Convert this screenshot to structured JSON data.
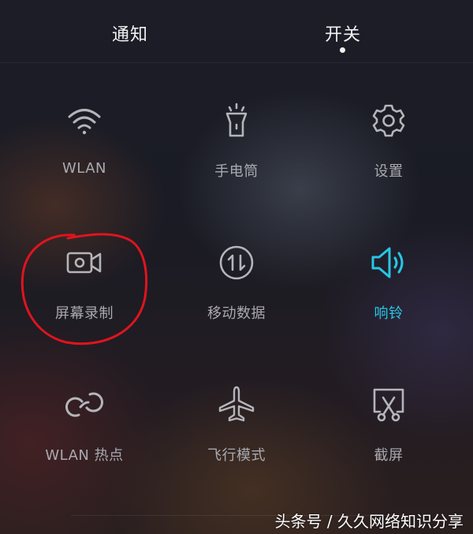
{
  "tabs": {
    "notify": "通知",
    "switch": "开关",
    "active": "开关"
  },
  "tiles": [
    {
      "label": "WLAN",
      "icon": "wifi-icon",
      "active": false
    },
    {
      "label": "手电筒",
      "icon": "flashlight-icon",
      "active": false
    },
    {
      "label": "设置",
      "icon": "gear-icon",
      "active": false
    },
    {
      "label": "屏幕录制",
      "icon": "video-camera-icon",
      "active": false
    },
    {
      "label": "移动数据",
      "icon": "mobile-data-icon",
      "active": false
    },
    {
      "label": "响铃",
      "icon": "speaker-icon",
      "active": true
    },
    {
      "label": "WLAN 热点",
      "icon": "hotspot-icon",
      "active": false
    },
    {
      "label": "飞行模式",
      "icon": "airplane-icon",
      "active": false
    },
    {
      "label": "截屏",
      "icon": "screenshot-icon",
      "active": false
    }
  ],
  "colors": {
    "accent": "#28c6e6",
    "icon": "#b4b5ba",
    "annotation": "#e0141e"
  },
  "watermark": "头条号 / 久久网络知识分享"
}
